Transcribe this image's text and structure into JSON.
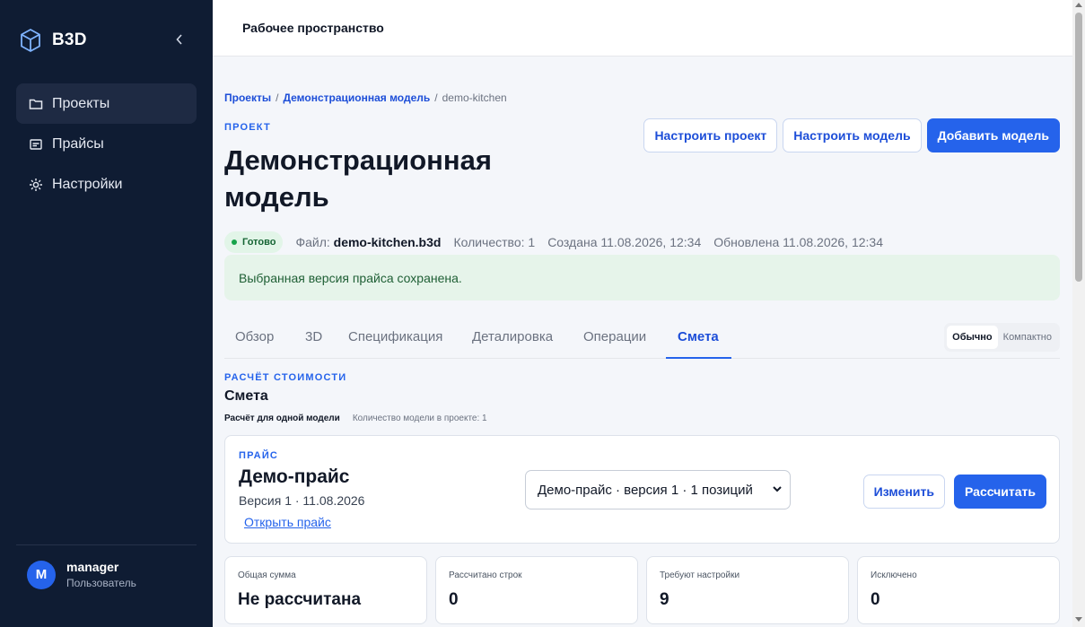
{
  "colors": {
    "sidebar_bg": "#0f1c33",
    "accent": "#2563eb",
    "success_bg": "#e6f4ea"
  },
  "sidebar": {
    "brand": {
      "name": "B3D",
      "icon": "cube-icon"
    },
    "collapse_icon": "chevron-left-icon",
    "items": [
      {
        "label": "Проекты",
        "icon": "folder-icon",
        "active": true
      },
      {
        "label": "Прайсы",
        "icon": "price-list-icon",
        "active": false
      },
      {
        "label": "Настройки",
        "icon": "gear-icon",
        "active": false
      }
    ],
    "user": {
      "initial": "M",
      "name": "manager",
      "role": "Пользователь"
    }
  },
  "topbar": {
    "title": "Рабочее пространство"
  },
  "breadcrumb": {
    "items": [
      "Проекты",
      "Демонстрационная модель",
      "demo-kitchen"
    ],
    "separator": "/"
  },
  "project": {
    "eyebrow": "ПРОЕКТ",
    "title": "Демонстрационная модель",
    "actions": {
      "configure_project": "Настроить проект",
      "configure_model": "Настроить модель",
      "add_model": "Добавить модель"
    },
    "status": "Готово",
    "file_label": "Файл:",
    "file_name": "demo-kitchen.b3d",
    "quantity": "Количество: 1",
    "created": "Создана 11.08.2026, 12:34",
    "updated": "Обновлена 11.08.2026, 12:34"
  },
  "alert": {
    "text": "Выбранная версия прайса сохранена."
  },
  "tabs": {
    "items": [
      "Обзор",
      "3D",
      "Спецификация",
      "Деталировка",
      "Операции",
      "Смета"
    ],
    "active": "Смета",
    "density": {
      "normal": "Обычно",
      "compact": "Компактно",
      "selected": "Обычно"
    }
  },
  "estimate": {
    "eyebrow": "РАСЧЁТ СТОИМОСТИ",
    "title": "Смета",
    "subtitle_bold": "Расчёт для одной модели",
    "subtitle_note": "Количество модели в проекте: 1"
  },
  "price": {
    "eyebrow": "ПРАЙС",
    "name": "Демо-прайс",
    "version": "Версия 1 · 11.08.2026",
    "open_link": "Открыть прайс",
    "select_value": "Демо-прайс · версия 1 · 1 позиций",
    "change_button": "Изменить",
    "calculate_button": "Рассчитать"
  },
  "stats": [
    {
      "label": "Общая сумма",
      "value": "Не рассчитана"
    },
    {
      "label": "Рассчитано строк",
      "value": "0"
    },
    {
      "label": "Требуют настройки",
      "value": "9"
    },
    {
      "label": "Исключено",
      "value": "0"
    }
  ]
}
